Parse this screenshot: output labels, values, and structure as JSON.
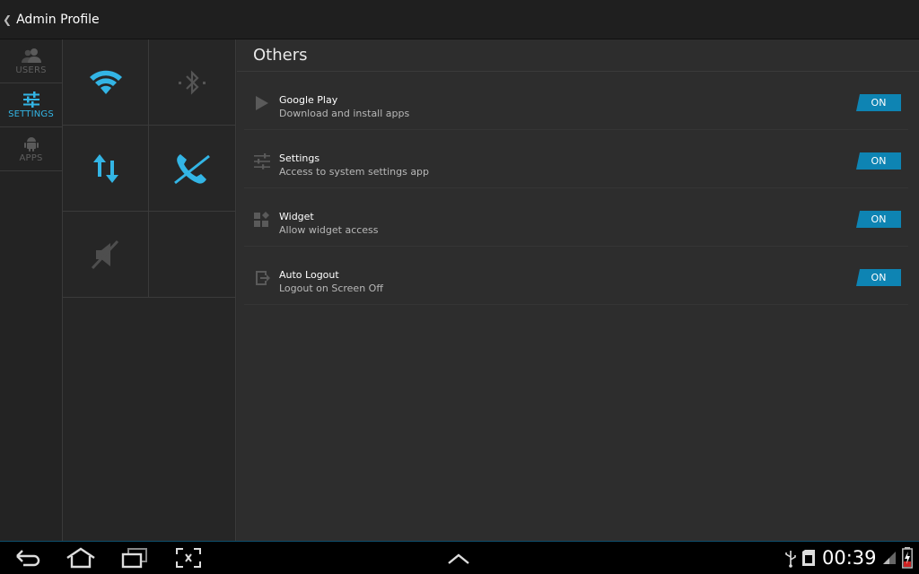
{
  "actionbar": {
    "title": "Admin Profile"
  },
  "nav": {
    "items": [
      {
        "label": "USERS",
        "icon": "users-icon",
        "active": false
      },
      {
        "label": "SETTINGS",
        "icon": "sliders-icon",
        "active": true
      },
      {
        "label": "APPS",
        "icon": "android-icon",
        "active": false
      }
    ]
  },
  "toggles": [
    {
      "name": "wifi",
      "state": "on"
    },
    {
      "name": "bluetooth",
      "state": "off"
    },
    {
      "name": "mobile-data",
      "state": "on"
    },
    {
      "name": "phone-calls",
      "state": "blocked"
    },
    {
      "name": "sound",
      "state": "muted"
    }
  ],
  "content": {
    "section_title": "Others",
    "rows": [
      {
        "title": "Google Play",
        "subtitle": "Download and install apps",
        "toggle": "ON",
        "icon": "play-icon"
      },
      {
        "title": "Settings",
        "subtitle": "Access to system settings app",
        "toggle": "ON",
        "icon": "sliders-icon"
      },
      {
        "title": "Widget",
        "subtitle": "Allow widget access",
        "toggle": "ON",
        "icon": "widget-icon"
      },
      {
        "title": "Auto Logout",
        "subtitle": "Logout on Screen Off",
        "toggle": "ON",
        "icon": "logout-icon"
      }
    ]
  },
  "statusbar": {
    "time": "00:39"
  },
  "colors": {
    "accent": "#33b5e5",
    "toggle_on": "#0e84b3",
    "icon_inactive": "#5a5a5a"
  }
}
